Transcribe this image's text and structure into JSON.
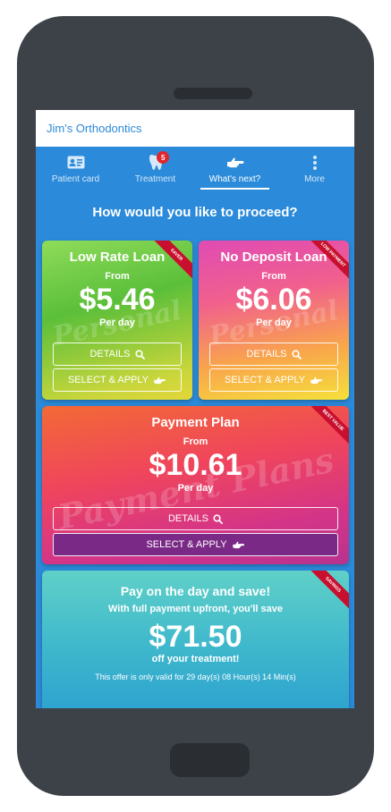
{
  "app": {
    "practice_name": "Jim's Orthodontics"
  },
  "tabs": [
    {
      "label": "Patient card",
      "icon": "id-card-icon"
    },
    {
      "label": "Treatment",
      "icon": "tooth-icon",
      "badge": "5"
    },
    {
      "label": "What's next?",
      "icon": "pointing-hand-icon",
      "active": true
    },
    {
      "label": "More",
      "icon": "vertical-dots-icon"
    }
  ],
  "heading": "How would you like to proceed?",
  "options": {
    "low_rate": {
      "title": "Low Rate Loan",
      "ribbon": "SAVER",
      "from": "From",
      "price": "$5.46",
      "per": "Per day",
      "details": "DETAILS",
      "apply": "SELECT & APPLY"
    },
    "no_deposit": {
      "title": "No Deposit Loan",
      "ribbon": "LOW PAYMENT",
      "from": "From",
      "price": "$6.06",
      "per": "Per day",
      "details": "DETAILS",
      "apply": "SELECT & APPLY"
    },
    "payment_plan": {
      "title": "Payment Plan",
      "ribbon": "BEST VALUE",
      "from": "From",
      "price": "$10.61",
      "per": "Per day",
      "details": "DETAILS",
      "apply": "SELECT & APPLY"
    },
    "pay_on_day": {
      "title": "Pay on the day and save!",
      "ribbon": "SAVINGS",
      "subtitle": "With full payment upfront, you'll save",
      "price": "$71.50",
      "suffix": "off your treatment!",
      "offer": "This offer is only valid for 29 day(s) 08 Hour(s) 14 Min(s)"
    }
  },
  "watermarks": {
    "personal": "Personal",
    "payment_plans": "Payment Plans"
  },
  "colors": {
    "brand_blue": "#2b8ad9",
    "ribbon_red": "#c8102e",
    "badge_red": "#e0262f"
  }
}
